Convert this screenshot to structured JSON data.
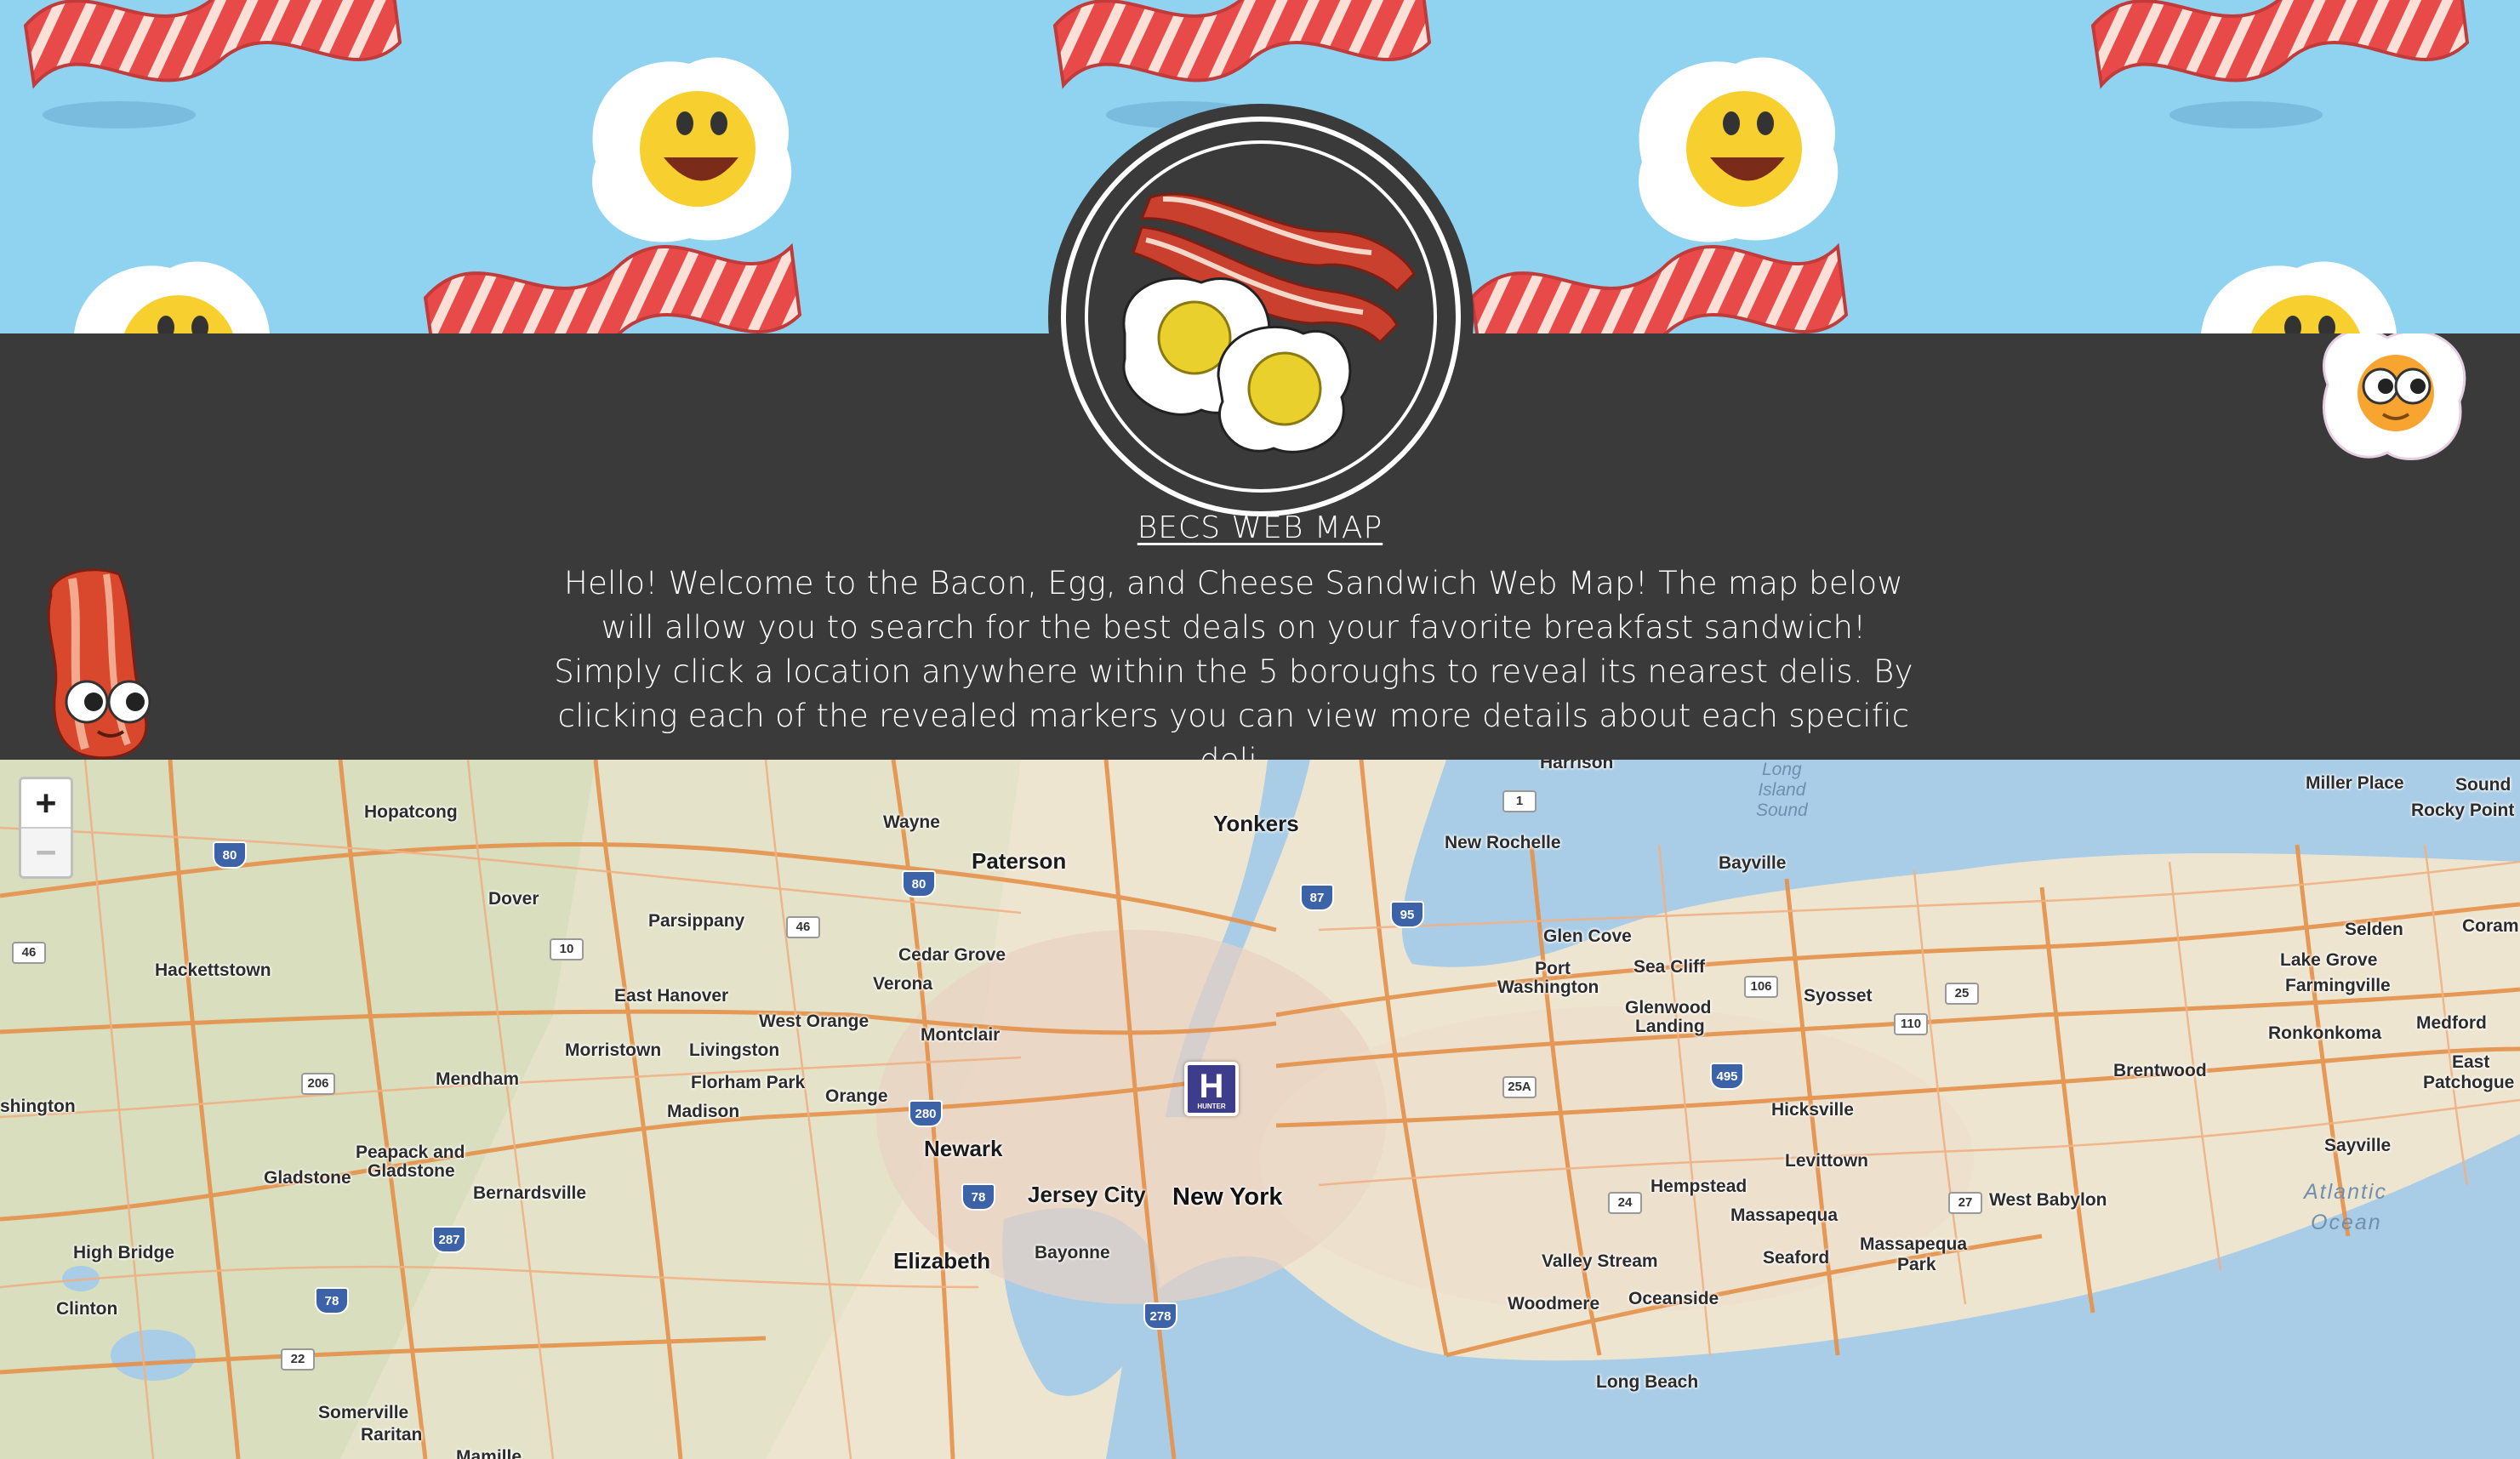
{
  "header": {
    "title": "BECS WEB MAP",
    "intro": "Hello! Welcome to the Bacon, Egg, and Cheese Sandwich Web Map! The map below will allow you to search for the best deals on your favorite breakfast sandwich! Simply click a location anywhere within the 5 boroughs to reveal its nearest delis. By clicking each of the revealed markers you can view more details about each specific deli."
  },
  "map": {
    "zoom_in": "+",
    "zoom_out": "−",
    "hospital_label": "H",
    "hospital_sub": "HUNTER",
    "places": [
      {
        "name": "Hopatcong",
        "cls": ""
      },
      {
        "name": "Wayne",
        "cls": ""
      },
      {
        "name": "Paterson",
        "cls": "city"
      },
      {
        "name": "Yonkers",
        "cls": "city"
      },
      {
        "name": "Harrison",
        "cls": ""
      },
      {
        "name": "New Rochelle",
        "cls": ""
      },
      {
        "name": "Bayville",
        "cls": ""
      },
      {
        "name": "Miller Place",
        "cls": ""
      },
      {
        "name": "Sound",
        "cls": ""
      },
      {
        "name": "Rocky Point",
        "cls": ""
      },
      {
        "name": "Dover",
        "cls": ""
      },
      {
        "name": "Parsippany",
        "cls": ""
      },
      {
        "name": "Cedar Grove",
        "cls": ""
      },
      {
        "name": "Verona",
        "cls": ""
      },
      {
        "name": "Hackettstown",
        "cls": ""
      },
      {
        "name": "East Hanover",
        "cls": ""
      },
      {
        "name": "West Orange",
        "cls": ""
      },
      {
        "name": "Montclair",
        "cls": ""
      },
      {
        "name": "Morristown",
        "cls": ""
      },
      {
        "name": "Livingston",
        "cls": ""
      },
      {
        "name": "Mendham",
        "cls": ""
      },
      {
        "name": "Florham Park",
        "cls": ""
      },
      {
        "name": "Orange",
        "cls": ""
      },
      {
        "name": "Madison",
        "cls": ""
      },
      {
        "name": "shington",
        "cls": ""
      },
      {
        "name": "Newark",
        "cls": "city"
      },
      {
        "name": "Peapack and",
        "cls": ""
      },
      {
        "name": "Gladstone",
        "cls": ""
      },
      {
        "name": "Gladstone",
        "cls": ""
      },
      {
        "name": "Bernardsville",
        "cls": ""
      },
      {
        "name": "Jersey City",
        "cls": "city"
      },
      {
        "name": "New York",
        "cls": "big"
      },
      {
        "name": "High Bridge",
        "cls": ""
      },
      {
        "name": "Elizabeth",
        "cls": "city"
      },
      {
        "name": "Bayonne",
        "cls": ""
      },
      {
        "name": "Clinton",
        "cls": ""
      },
      {
        "name": "Somerville",
        "cls": ""
      },
      {
        "name": "Raritan",
        "cls": ""
      },
      {
        "name": "Glen Cove",
        "cls": ""
      },
      {
        "name": "Port",
        "cls": ""
      },
      {
        "name": "Washington",
        "cls": ""
      },
      {
        "name": "Sea Cliff",
        "cls": ""
      },
      {
        "name": "Glenwood",
        "cls": ""
      },
      {
        "name": "Landing",
        "cls": ""
      },
      {
        "name": "Syosset",
        "cls": ""
      },
      {
        "name": "Selden",
        "cls": ""
      },
      {
        "name": "Coram",
        "cls": ""
      },
      {
        "name": "Lake Grove",
        "cls": ""
      },
      {
        "name": "Farmingville",
        "cls": ""
      },
      {
        "name": "Ronkonkoma",
        "cls": ""
      },
      {
        "name": "Medford",
        "cls": ""
      },
      {
        "name": "Brentwood",
        "cls": ""
      },
      {
        "name": "East",
        "cls": ""
      },
      {
        "name": "Patchogue",
        "cls": ""
      },
      {
        "name": "Hicksville",
        "cls": ""
      },
      {
        "name": "Levittown",
        "cls": ""
      },
      {
        "name": "Hempstead",
        "cls": ""
      },
      {
        "name": "Massapequa",
        "cls": ""
      },
      {
        "name": "West Babylon",
        "cls": ""
      },
      {
        "name": "Sayville",
        "cls": ""
      },
      {
        "name": "Valley Stream",
        "cls": ""
      },
      {
        "name": "Seaford",
        "cls": ""
      },
      {
        "name": "Massapequa",
        "cls": ""
      },
      {
        "name": "Park",
        "cls": ""
      },
      {
        "name": "Woodmere",
        "cls": ""
      },
      {
        "name": "Oceanside",
        "cls": ""
      },
      {
        "name": "Long Beach",
        "cls": ""
      },
      {
        "name": "Mamille",
        "cls": ""
      }
    ],
    "water": [
      {
        "name": "Atlantic"
      },
      {
        "name": "Ocean"
      }
    ],
    "sound_label": [
      "Long",
      "Island",
      "Sound"
    ],
    "shields": [
      {
        "num": "80",
        "cls": ""
      },
      {
        "num": "80",
        "cls": ""
      },
      {
        "num": "87",
        "cls": ""
      },
      {
        "num": "95",
        "cls": ""
      },
      {
        "num": "1",
        "cls": "white"
      },
      {
        "num": "46",
        "cls": "white"
      },
      {
        "num": "46",
        "cls": "white"
      },
      {
        "num": "10",
        "cls": "white"
      },
      {
        "num": "206",
        "cls": "white"
      },
      {
        "num": "280",
        "cls": ""
      },
      {
        "num": "78",
        "cls": ""
      },
      {
        "num": "287",
        "cls": ""
      },
      {
        "num": "78",
        "cls": ""
      },
      {
        "num": "22",
        "cls": "white"
      },
      {
        "num": "278",
        "cls": ""
      },
      {
        "num": "106",
        "cls": "white"
      },
      {
        "num": "25",
        "cls": "white"
      },
      {
        "num": "110",
        "cls": "white"
      },
      {
        "num": "495",
        "cls": ""
      },
      {
        "num": "25A",
        "cls": "white"
      },
      {
        "num": "24",
        "cls": "white"
      },
      {
        "num": "27",
        "cls": "white"
      }
    ]
  }
}
